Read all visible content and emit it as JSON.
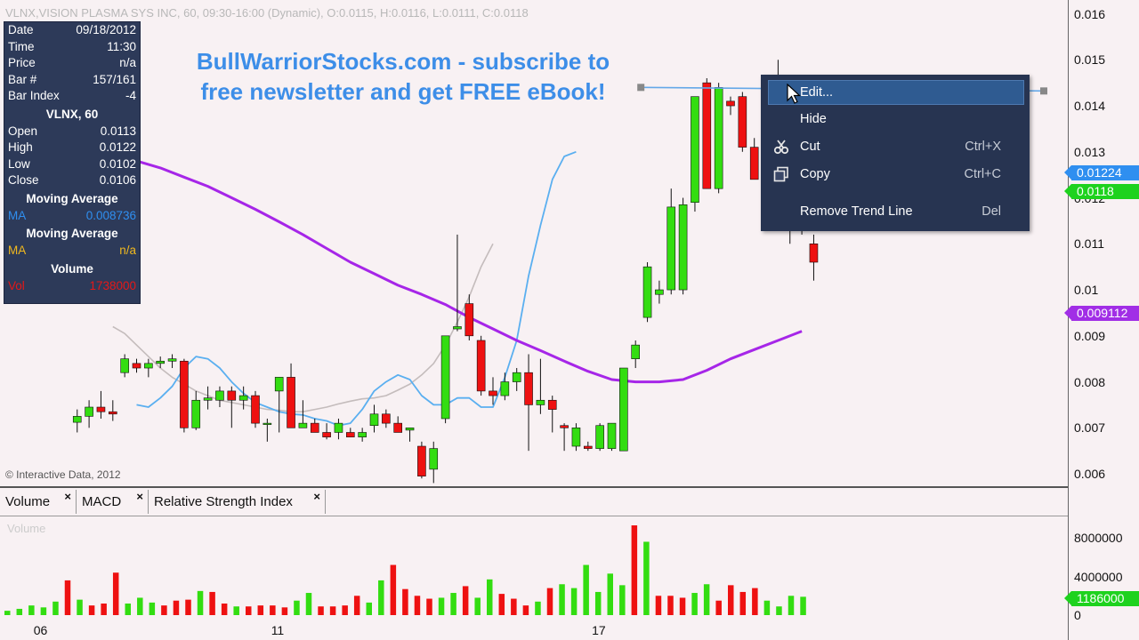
{
  "header": {
    "title": "VLNX,VISION PLASMA SYS INC, 60, 09:30-16:00 (Dynamic), O:0.0115, H:0.0116, L:0.0111, C:0.0118"
  },
  "promo": {
    "line1": "BullWarriorStocks.com - subscribe to",
    "line2": "free newsletter and get FREE eBook!"
  },
  "copyright": "© Interactive Data, 2012",
  "info_panel": {
    "rows_top": [
      {
        "label": "Date",
        "value": "09/18/2012"
      },
      {
        "label": "Time",
        "value": "11:30"
      },
      {
        "label": "Price",
        "value": "n/a"
      },
      {
        "label": "Bar #",
        "value": "157/161"
      },
      {
        "label": "Bar Index",
        "value": "-4"
      }
    ],
    "symbol_header": "VLNX, 60",
    "rows_ohlc": [
      {
        "label": "Open",
        "value": "0.0113"
      },
      {
        "label": "High",
        "value": "0.0122"
      },
      {
        "label": "Low",
        "value": "0.0102"
      },
      {
        "label": "Close",
        "value": "0.0106"
      }
    ],
    "ma1_header": "Moving Average",
    "ma1": {
      "label": "MA",
      "value": "0.008736"
    },
    "ma2_header": "Moving Average",
    "ma2": {
      "label": "MA",
      "value": "n/a"
    },
    "volume_header": "Volume",
    "volume": {
      "label": "Vol",
      "value": "1738000"
    }
  },
  "tabs": [
    {
      "label": "Volume"
    },
    {
      "label": "MACD"
    },
    {
      "label": "Relative Strength Index"
    }
  ],
  "tab_close_glyph": "×",
  "volume_pane_label": "Volume",
  "context_menu": {
    "items": [
      {
        "label": "Edit...",
        "shortcut": "",
        "icon": "none"
      },
      {
        "label": "Hide",
        "shortcut": "",
        "icon": "none"
      },
      {
        "label": "Cut",
        "shortcut": "Ctrl+X",
        "icon": "scissors-icon"
      },
      {
        "label": "Copy",
        "shortcut": "Ctrl+C",
        "icon": "copy-icon"
      },
      {
        "label": "Remove Trend Line",
        "shortcut": "Del",
        "icon": "none"
      }
    ]
  },
  "price_tags": {
    "blue": {
      "text": "0.01224",
      "color": "#2f8ff0"
    },
    "green": {
      "text": "0.0118",
      "color": "#1ed21e"
    },
    "purple": {
      "text": "0.009112",
      "color": "#a12ee6"
    },
    "volume": {
      "text": "1186000",
      "color": "#1ed21e"
    }
  },
  "colors": {
    "up": "#33dd11",
    "down": "#ee1111",
    "ma_fast": "#5aaff0",
    "ma_mid": "#c4bcbc",
    "ma_slow": "#a626e8",
    "trendline": "#64a8e8"
  },
  "chart_data": {
    "type": "candlestick",
    "x_tick_labels": [
      {
        "label": "06",
        "bar": 2
      },
      {
        "label": "11",
        "bar": 22
      },
      {
        "label": "17",
        "bar": 49
      }
    ],
    "y_ticks": [
      "0.006",
      "0.007",
      "0.008",
      "0.009",
      "0.01",
      "0.011",
      "0.012",
      "0.013",
      "0.014",
      "0.015",
      "0.016"
    ],
    "ylim": [
      0.00575,
      0.0163
    ],
    "volume_ticks": [
      {
        "label": "0",
        "value": 0
      },
      {
        "label": "4000000",
        "value": 4000000
      },
      {
        "label": "8000000",
        "value": 8000000
      }
    ],
    "volume_ylim": [
      0,
      10500000
    ],
    "candles": [
      [
        0.00712,
        0.0074,
        0.0069,
        0.00725
      ],
      [
        0.00725,
        0.0076,
        0.007,
        0.00745
      ],
      [
        0.00745,
        0.0078,
        0.0072,
        0.00735
      ],
      [
        0.00735,
        0.0076,
        0.00715,
        0.0073
      ],
      [
        0.0082,
        0.0086,
        0.0081,
        0.0085
      ],
      [
        0.0084,
        0.0085,
        0.0082,
        0.0083
      ],
      [
        0.0083,
        0.0085,
        0.0081,
        0.0084
      ],
      [
        0.0084,
        0.00855,
        0.0083,
        0.00845
      ],
      [
        0.00845,
        0.0086,
        0.0083,
        0.0085
      ],
      [
        0.00845,
        0.0085,
        0.0069,
        0.007
      ],
      [
        0.007,
        0.0078,
        0.00695,
        0.0076
      ],
      [
        0.0076,
        0.0079,
        0.0074,
        0.00765
      ],
      [
        0.0076,
        0.0079,
        0.00745,
        0.0078
      ],
      [
        0.0078,
        0.0079,
        0.007,
        0.0076
      ],
      [
        0.0076,
        0.0079,
        0.0074,
        0.0077
      ],
      [
        0.0077,
        0.0078,
        0.007,
        0.0071
      ],
      [
        0.0071,
        0.0072,
        0.0067,
        0.0071
      ],
      [
        0.0078,
        0.0081,
        0.0069,
        0.0081
      ],
      [
        0.0081,
        0.0084,
        0.007,
        0.007
      ],
      [
        0.007,
        0.0076,
        0.007,
        0.0071
      ],
      [
        0.0071,
        0.0072,
        0.0069,
        0.0069
      ],
      [
        0.0069,
        0.0071,
        0.00675,
        0.0068
      ],
      [
        0.0069,
        0.0072,
        0.00675,
        0.0071
      ],
      [
        0.0069,
        0.007,
        0.0068,
        0.0068
      ],
      [
        0.0068,
        0.007,
        0.0067,
        0.0069
      ],
      [
        0.00705,
        0.0075,
        0.0069,
        0.0073
      ],
      [
        0.0073,
        0.0074,
        0.007,
        0.0071
      ],
      [
        0.0071,
        0.00725,
        0.0069,
        0.0069
      ],
      [
        0.00695,
        0.007,
        0.0067,
        0.007
      ],
      [
        0.0066,
        0.0067,
        0.0059,
        0.00595
      ],
      [
        0.0061,
        0.0067,
        0.0058,
        0.00655
      ],
      [
        0.0072,
        0.009,
        0.0071,
        0.009
      ],
      [
        0.00915,
        0.0112,
        0.0091,
        0.0092
      ],
      [
        0.0097,
        0.0099,
        0.0089,
        0.009
      ],
      [
        0.0089,
        0.009,
        0.0077,
        0.0078
      ],
      [
        0.0078,
        0.0081,
        0.0075,
        0.0077
      ],
      [
        0.0077,
        0.0082,
        0.0076,
        0.008
      ],
      [
        0.008,
        0.0083,
        0.0078,
        0.0082
      ],
      [
        0.0082,
        0.0086,
        0.0065,
        0.0075
      ],
      [
        0.0075,
        0.0085,
        0.0073,
        0.0076
      ],
      [
        0.0076,
        0.0077,
        0.0069,
        0.0074
      ],
      [
        0.00705,
        0.0071,
        0.0065,
        0.007
      ],
      [
        0.0066,
        0.0071,
        0.0065,
        0.007
      ],
      [
        0.0066,
        0.0067,
        0.0065,
        0.00655
      ],
      [
        0.00655,
        0.0071,
        0.0065,
        0.00705
      ],
      [
        0.00655,
        0.0071,
        0.0065,
        0.0071
      ],
      [
        0.0065,
        0.0083,
        0.0065,
        0.0083
      ],
      [
        0.0085,
        0.0089,
        0.0083,
        0.0088
      ],
      [
        0.0094,
        0.0106,
        0.0093,
        0.0105
      ],
      [
        0.0099,
        0.0102,
        0.0097,
        0.01
      ],
      [
        0.01,
        0.0122,
        0.0099,
        0.0118
      ],
      [
        0.01,
        0.012,
        0.0099,
        0.01185
      ],
      [
        0.0119,
        0.0132,
        0.0117,
        0.0142
      ],
      [
        0.0145,
        0.0146,
        0.0122,
        0.0122
      ],
      [
        0.0122,
        0.0145,
        0.0121,
        0.0144
      ],
      [
        0.0141,
        0.0142,
        0.0138,
        0.014
      ],
      [
        0.0142,
        0.0143,
        0.013,
        0.0131
      ],
      [
        0.0131,
        0.0133,
        0.0125,
        0.0124
      ],
      [
        0.0124,
        0.0141,
        0.0122,
        0.0141
      ],
      [
        0.0136,
        0.015,
        0.0135,
        0.0142
      ],
      [
        0.0144,
        0.0145,
        0.011,
        0.012
      ],
      [
        0.012,
        0.0121,
        0.0112,
        0.0113
      ],
      [
        0.011,
        0.0112,
        0.0102,
        0.0106
      ]
    ],
    "volume": [
      [
        450000,
        "up"
      ],
      [
        650000,
        "up"
      ],
      [
        1000000,
        "up"
      ],
      [
        800000,
        "up"
      ],
      [
        1400000,
        "up"
      ],
      [
        3600000,
        "down"
      ],
      [
        1600000,
        "up"
      ],
      [
        1000000,
        "down"
      ],
      [
        1200000,
        "down"
      ],
      [
        4400000,
        "down"
      ],
      [
        1200000,
        "up"
      ],
      [
        1800000,
        "up"
      ],
      [
        1300000,
        "up"
      ],
      [
        1000000,
        "down"
      ],
      [
        1500000,
        "down"
      ],
      [
        1600000,
        "down"
      ],
      [
        2500000,
        "up"
      ],
      [
        2400000,
        "down"
      ],
      [
        1200000,
        "down"
      ],
      [
        900000,
        "up"
      ],
      [
        900000,
        "down"
      ],
      [
        1000000,
        "down"
      ],
      [
        1000000,
        "down"
      ],
      [
        800000,
        "down"
      ],
      [
        1500000,
        "up"
      ],
      [
        2300000,
        "up"
      ],
      [
        900000,
        "down"
      ],
      [
        900000,
        "down"
      ],
      [
        1000000,
        "down"
      ],
      [
        2000000,
        "down"
      ],
      [
        1300000,
        "up"
      ],
      [
        3600000,
        "up"
      ],
      [
        5200000,
        "down"
      ],
      [
        2700000,
        "down"
      ],
      [
        2000000,
        "down"
      ],
      [
        1700000,
        "down"
      ],
      [
        1800000,
        "up"
      ],
      [
        2300000,
        "up"
      ],
      [
        3000000,
        "down"
      ],
      [
        1800000,
        "up"
      ],
      [
        3700000,
        "up"
      ],
      [
        2200000,
        "down"
      ],
      [
        1700000,
        "down"
      ],
      [
        1000000,
        "down"
      ],
      [
        1400000,
        "up"
      ],
      [
        2800000,
        "down"
      ],
      [
        3200000,
        "up"
      ],
      [
        2800000,
        "up"
      ],
      [
        5200000,
        "up"
      ],
      [
        2400000,
        "up"
      ],
      [
        4300000,
        "up"
      ],
      [
        3100000,
        "up"
      ],
      [
        9300000,
        "down"
      ],
      [
        7600000,
        "up"
      ],
      [
        2000000,
        "down"
      ],
      [
        2000000,
        "down"
      ],
      [
        1800000,
        "down"
      ],
      [
        2300000,
        "up"
      ],
      [
        3200000,
        "up"
      ],
      [
        1500000,
        "down"
      ],
      [
        3100000,
        "down"
      ],
      [
        2400000,
        "down"
      ],
      [
        2800000,
        "down"
      ],
      [
        1500000,
        "up"
      ],
      [
        900000,
        "up"
      ],
      [
        2000000,
        "up"
      ],
      [
        1900000,
        "up"
      ]
    ],
    "ma_fast": [
      0.0075,
      0.00745,
      0.00765,
      0.0079,
      0.0083,
      0.00855,
      0.0085,
      0.0083,
      0.008,
      0.00775,
      0.00755,
      0.00745,
      0.00735,
      0.0073,
      0.00728,
      0.0072,
      0.00715,
      0.00705,
      0.0071,
      0.0074,
      0.0078,
      0.008,
      0.00815,
      0.00805,
      0.0077,
      0.0075,
      0.0075,
      0.00765,
      0.00765,
      0.00745,
      0.00745,
      0.0081,
      0.0089,
      0.0103,
      0.0114,
      0.0124,
      0.0129,
      0.013
    ],
    "ma_fast_start": 10,
    "ma_mid": [
      0.0092,
      0.00905,
      0.0088,
      0.00855,
      0.0083,
      0.0081,
      0.00795,
      0.0078,
      0.0077,
      0.0076,
      0.00755,
      0.0075,
      0.00745,
      0.0074,
      0.00738,
      0.00735,
      0.00735,
      0.0074,
      0.00745,
      0.00752,
      0.00758,
      0.00763,
      0.00765,
      0.0077,
      0.00782,
      0.00795,
      0.00815,
      0.0084,
      0.0088,
      0.0093,
      0.00985,
      0.0105,
      0.011
    ],
    "ma_mid_start": 8,
    "ma_slow": [
      0.0128,
      0.01265,
      0.01245,
      0.01225,
      0.012,
      0.01175,
      0.01148,
      0.0112,
      0.0109,
      0.0106,
      0.01035,
      0.0101,
      0.0099,
      0.00968,
      0.0094,
      0.00915,
      0.0089,
      0.00868,
      0.00845,
      0.00823,
      0.00805,
      0.008,
      0.008,
      0.00805,
      0.00825,
      0.0085,
      0.0087,
      0.0089,
      0.0091
    ],
    "ma_slow_start": 10,
    "ma_slow_step": 2,
    "trendline": {
      "from_bar": 52,
      "to_bar": 85,
      "price": 0.0144
    }
  }
}
